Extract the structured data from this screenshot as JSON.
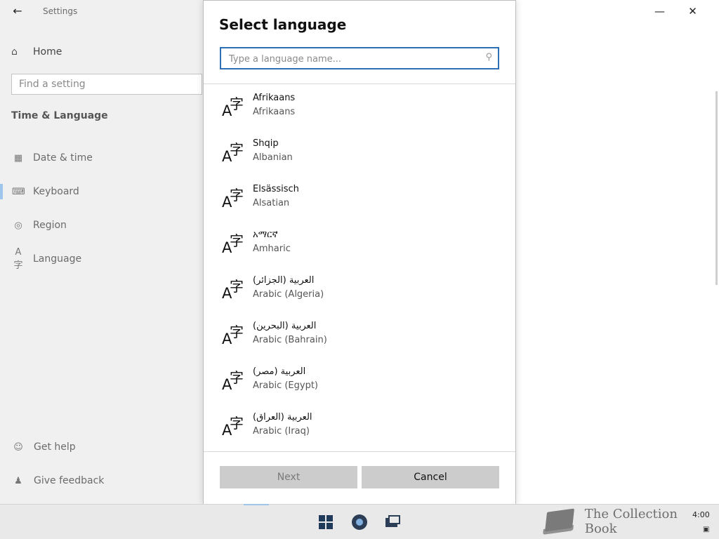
{
  "window": {
    "title": "Settings",
    "back_glyph": "←",
    "minimize_glyph": "—",
    "close_glyph": "✕"
  },
  "sidebar": {
    "home": {
      "label": "Home",
      "icon": "home-icon"
    },
    "find_placeholder": "Find a setting",
    "section_title": "Time & Language",
    "items": [
      {
        "label": "Date & time",
        "icon": "calendar-clock-icon",
        "selected": false
      },
      {
        "label": "Keyboard",
        "icon": "keyboard-icon",
        "selected": true
      },
      {
        "label": "Region",
        "icon": "globe-icon",
        "selected": false
      },
      {
        "label": "Language",
        "icon": "language-icon",
        "selected": false
      }
    ],
    "help": {
      "label": "Get help",
      "icon": "help-chat-icon"
    },
    "feedback": {
      "label": "Give feedback",
      "icon": "feedback-person-icon"
    }
  },
  "dialog": {
    "title": "Select language",
    "search_placeholder": "Type a language name...",
    "search_value": "",
    "languages": [
      {
        "native": "Afrikaans",
        "english": "Afrikaans"
      },
      {
        "native": "Shqip",
        "english": "Albanian"
      },
      {
        "native": "Elsässisch",
        "english": "Alsatian"
      },
      {
        "native": "አማርኛ",
        "english": "Amharic"
      },
      {
        "native": "العربية (الجزائر)",
        "english": "Arabic (Algeria)"
      },
      {
        "native": "العربية (البحرين)",
        "english": "Arabic (Bahrain)"
      },
      {
        "native": "العربية (مصر)",
        "english": "Arabic (Egypt)"
      },
      {
        "native": "العربية (العراق)",
        "english": "Arabic (Iraq)"
      }
    ],
    "next_label": "Next",
    "cancel_label": "Cancel"
  },
  "taskbar": {
    "time": "4:00",
    "watermark": "The Collection Book",
    "icons": [
      "windows-start-icon",
      "settings-gear-icon",
      "task-view-icon"
    ]
  },
  "colors": {
    "accent": "#2d6fb7",
    "selection_bar": "#9ec6ec",
    "button_bg": "#cccccc"
  }
}
